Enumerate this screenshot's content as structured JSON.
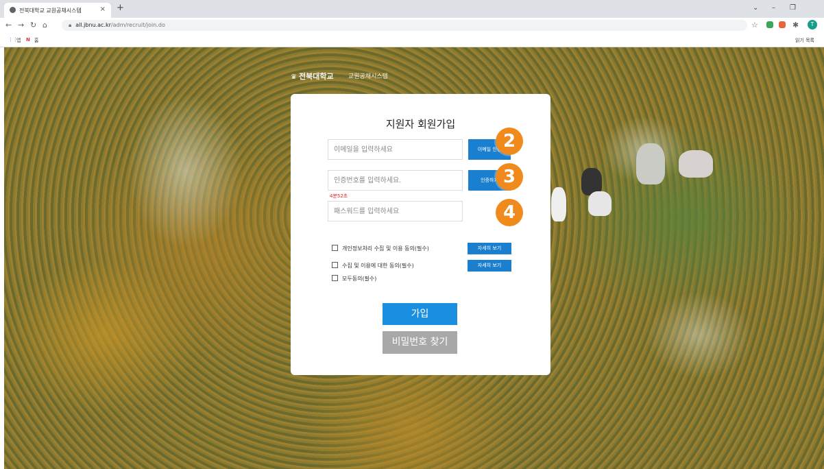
{
  "browser": {
    "tab_title": "전북대학교 교원공채시스템",
    "tab_close": "×",
    "new_tab": "+",
    "url_host": "all.jbnu.ac.kr",
    "url_path": "/adm/recruit/join.do",
    "profile_initial": "T",
    "bookmarks": [
      "앱",
      "N",
      "홈"
    ],
    "reading_list": "읽기 목록"
  },
  "site": {
    "logo": "전북대학교",
    "subtitle": "교원공채시스템"
  },
  "form": {
    "title": "지원자 회원가입",
    "email_placeholder": "이메일을 입력하세요",
    "email_button": "이메일 인증",
    "code_placeholder": "인증번호를 입력하세요.",
    "code_button": "인증하기",
    "timer": "4분52초",
    "password_placeholder": "패스워드를 입력하세요",
    "agree_privacy": "개인정보처리 수집 및 이용 동의(필수)",
    "agree_usage": "수집 및 이용에 대한 동의(필수)",
    "agree_all": "모두동의(필수)",
    "detail_button": "자세히 보기",
    "join_button": "가입",
    "find_password_button": "비밀번호 찾기"
  },
  "markers": [
    "2",
    "3",
    "4"
  ],
  "colors": {
    "primary_blue": "#1a7fcf",
    "marker_orange": "#f08a1c",
    "timer_red": "#e02020"
  }
}
